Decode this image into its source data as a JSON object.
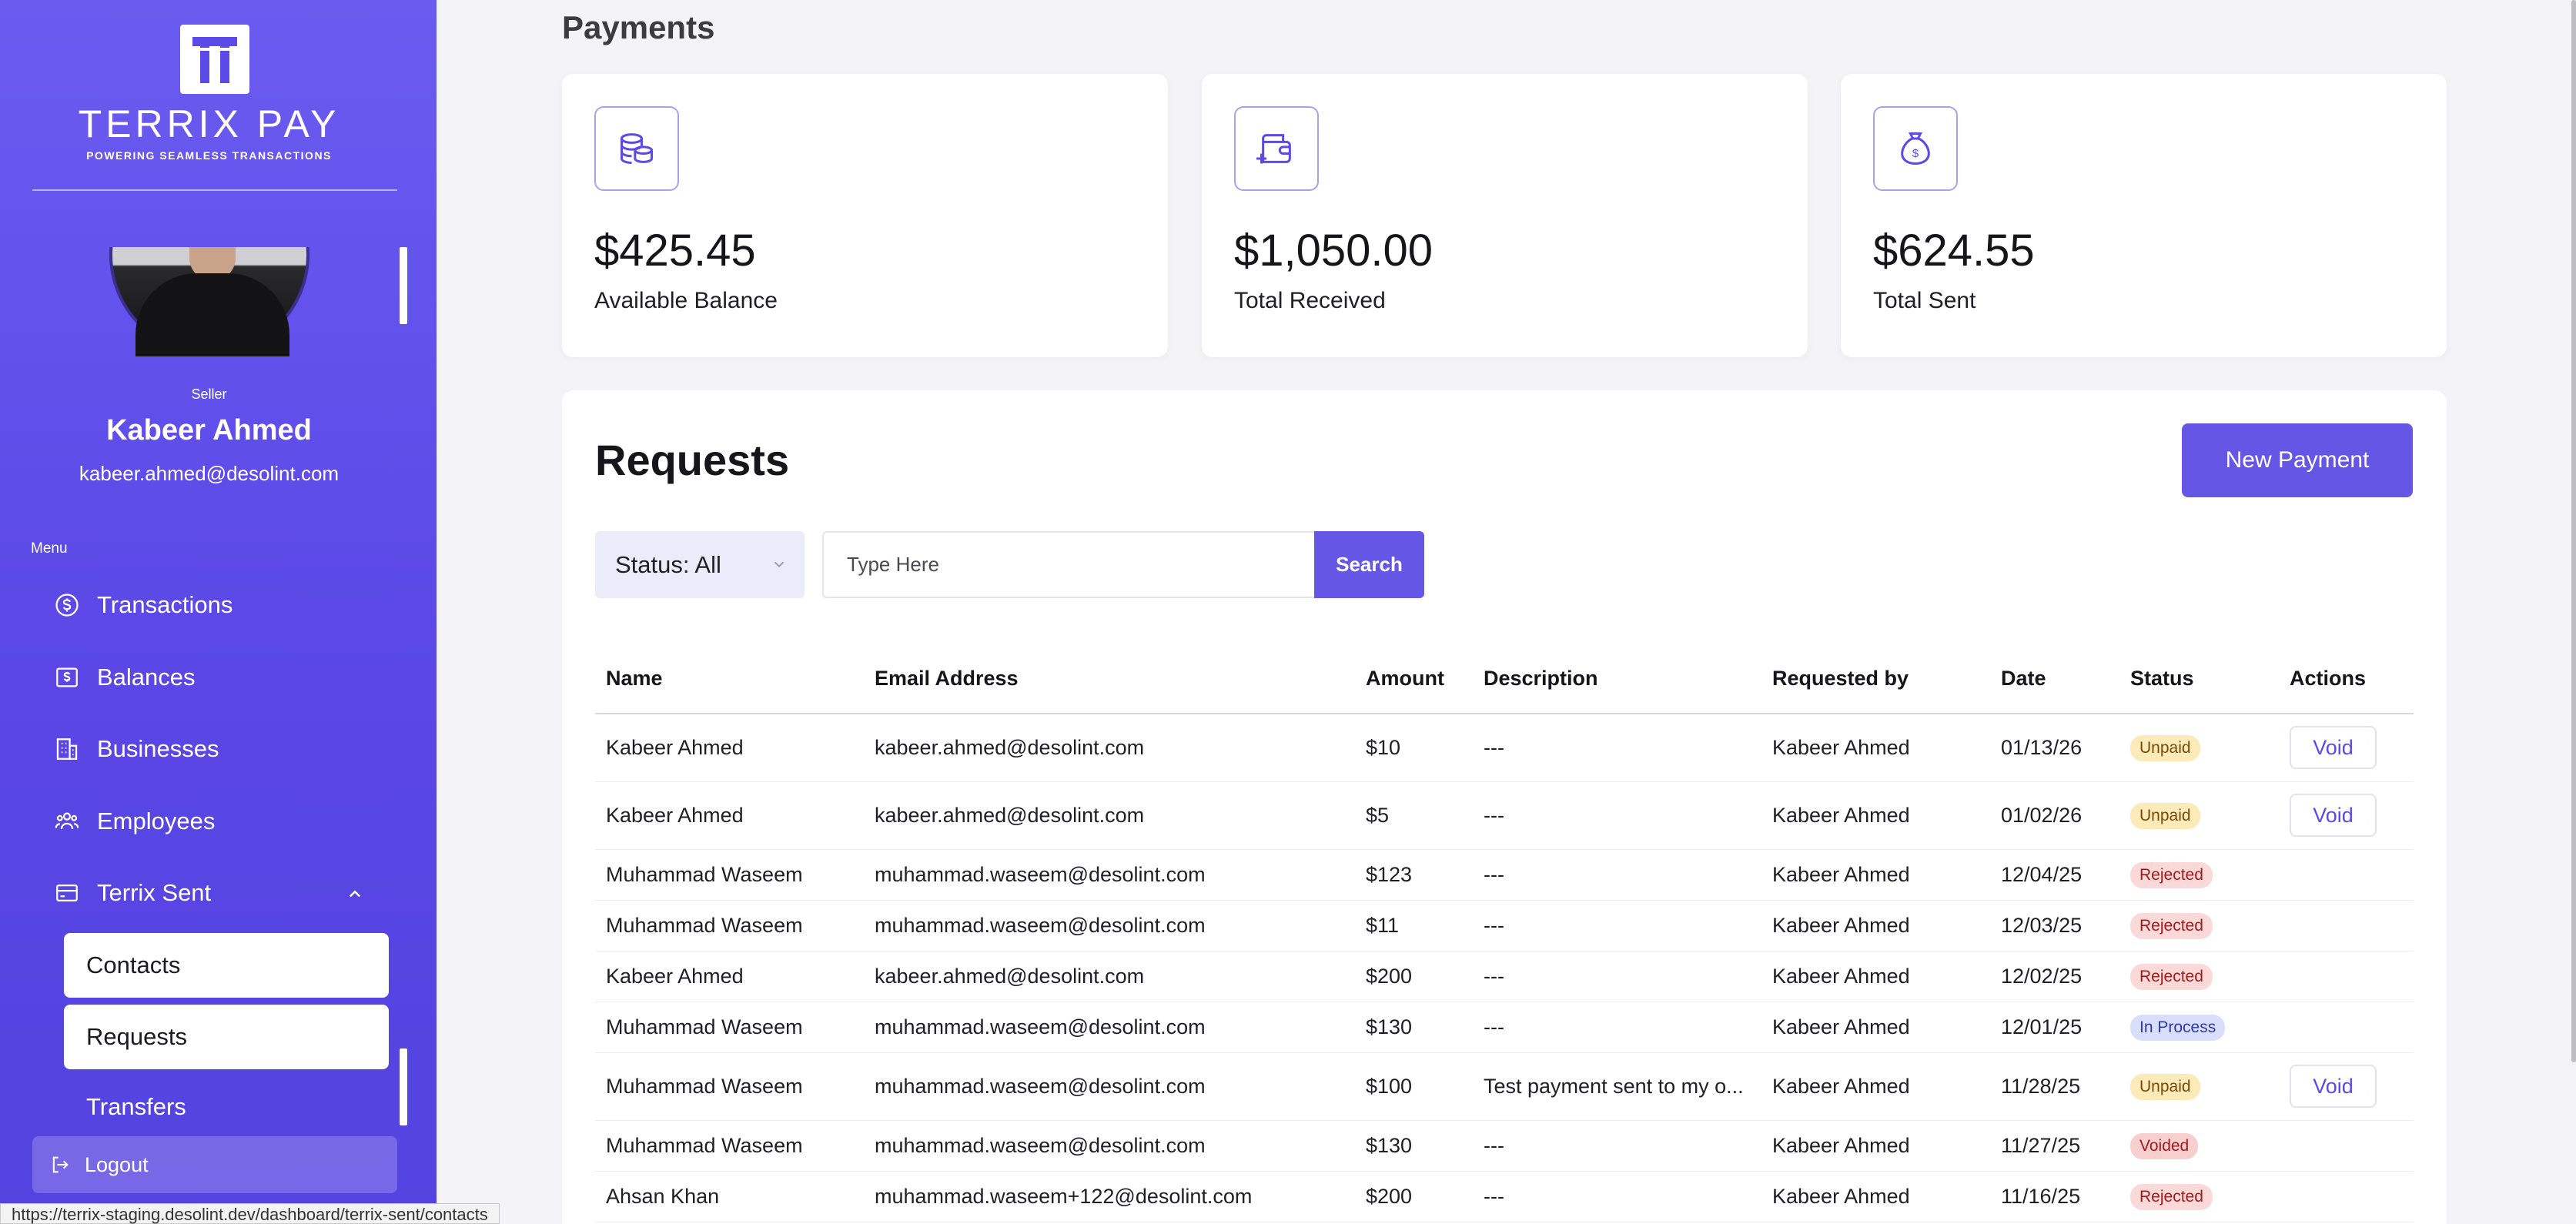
{
  "brand": {
    "name": "TERRIX PAY",
    "tagline": "POWERING SEAMLESS TRANSACTIONS"
  },
  "user": {
    "role": "Seller",
    "name": "Kabeer Ahmed",
    "email": "kabeer.ahmed@desolint.com"
  },
  "menu": {
    "label": "Menu",
    "items": [
      {
        "label": "Transactions",
        "icon": "dollar-circle-icon"
      },
      {
        "label": "Balances",
        "icon": "money-icon"
      },
      {
        "label": "Businesses",
        "icon": "building-icon"
      },
      {
        "label": "Employees",
        "icon": "users-icon"
      },
      {
        "label": "Terrix Sent",
        "icon": "card-icon"
      }
    ],
    "sub_items": [
      {
        "label": "Contacts"
      },
      {
        "label": "Requests"
      },
      {
        "label": "Transfers"
      }
    ],
    "logout": "Logout"
  },
  "status_bar_url": "https://terrix-staging.desolint.dev/dashboard/terrix-sent/contacts",
  "page": {
    "title": "Payments"
  },
  "stats": [
    {
      "value": "$425.45",
      "label": "Available Balance",
      "icon": "coins-icon"
    },
    {
      "value": "$1,050.00",
      "label": "Total Received",
      "icon": "wallet-add-icon"
    },
    {
      "value": "$624.55",
      "label": "Total Sent",
      "icon": "money-bag-icon"
    }
  ],
  "requests": {
    "title": "Requests",
    "new_payment": "New Payment",
    "status_filter": "Status: All",
    "search_placeholder": "Type Here",
    "search_label": "Search",
    "columns": [
      "Name",
      "Email Address",
      "Amount",
      "Description",
      "Requested by",
      "Date",
      "Status",
      "Actions"
    ],
    "rows": [
      {
        "name": "Kabeer Ahmed",
        "email": "kabeer.ahmed@desolint.com",
        "amount": "$10",
        "description": "---",
        "requested_by": "Kabeer Ahmed",
        "date": "01/13/26",
        "status": "Unpaid",
        "action": "Void"
      },
      {
        "name": "Kabeer Ahmed",
        "email": "kabeer.ahmed@desolint.com",
        "amount": "$5",
        "description": "---",
        "requested_by": "Kabeer Ahmed",
        "date": "01/02/26",
        "status": "Unpaid",
        "action": "Void"
      },
      {
        "name": "Muhammad Waseem",
        "email": "muhammad.waseem@desolint.com",
        "amount": "$123",
        "description": "---",
        "requested_by": "Kabeer Ahmed",
        "date": "12/04/25",
        "status": "Rejected",
        "action": ""
      },
      {
        "name": "Muhammad Waseem",
        "email": "muhammad.waseem@desolint.com",
        "amount": "$11",
        "description": "---",
        "requested_by": "Kabeer Ahmed",
        "date": "12/03/25",
        "status": "Rejected",
        "action": ""
      },
      {
        "name": "Kabeer Ahmed",
        "email": "kabeer.ahmed@desolint.com",
        "amount": "$200",
        "description": "---",
        "requested_by": "Kabeer Ahmed",
        "date": "12/02/25",
        "status": "Rejected",
        "action": ""
      },
      {
        "name": "Muhammad Waseem",
        "email": "muhammad.waseem@desolint.com",
        "amount": "$130",
        "description": "---",
        "requested_by": "Kabeer Ahmed",
        "date": "12/01/25",
        "status": "In Process",
        "action": ""
      },
      {
        "name": "Muhammad Waseem",
        "email": "muhammad.waseem@desolint.com",
        "amount": "$100",
        "description": "Test payment sent to my o...",
        "requested_by": "Kabeer Ahmed",
        "date": "11/28/25",
        "status": "Unpaid",
        "action": "Void"
      },
      {
        "name": "Muhammad Waseem",
        "email": "muhammad.waseem@desolint.com",
        "amount": "$130",
        "description": "---",
        "requested_by": "Kabeer Ahmed",
        "date": "11/27/25",
        "status": "Voided",
        "action": ""
      },
      {
        "name": "Ahsan Khan",
        "email": "muhammad.waseem+122@desolint.com",
        "amount": "$200",
        "description": "---",
        "requested_by": "Kabeer Ahmed",
        "date": "11/16/25",
        "status": "Rejected",
        "action": ""
      }
    ]
  },
  "colors": {
    "accent": "#6656e6",
    "sidebar": "#5a47e6",
    "unpaid": "#fcebb8",
    "rejected": "#fbd9d9",
    "in_process": "#d9defc"
  }
}
